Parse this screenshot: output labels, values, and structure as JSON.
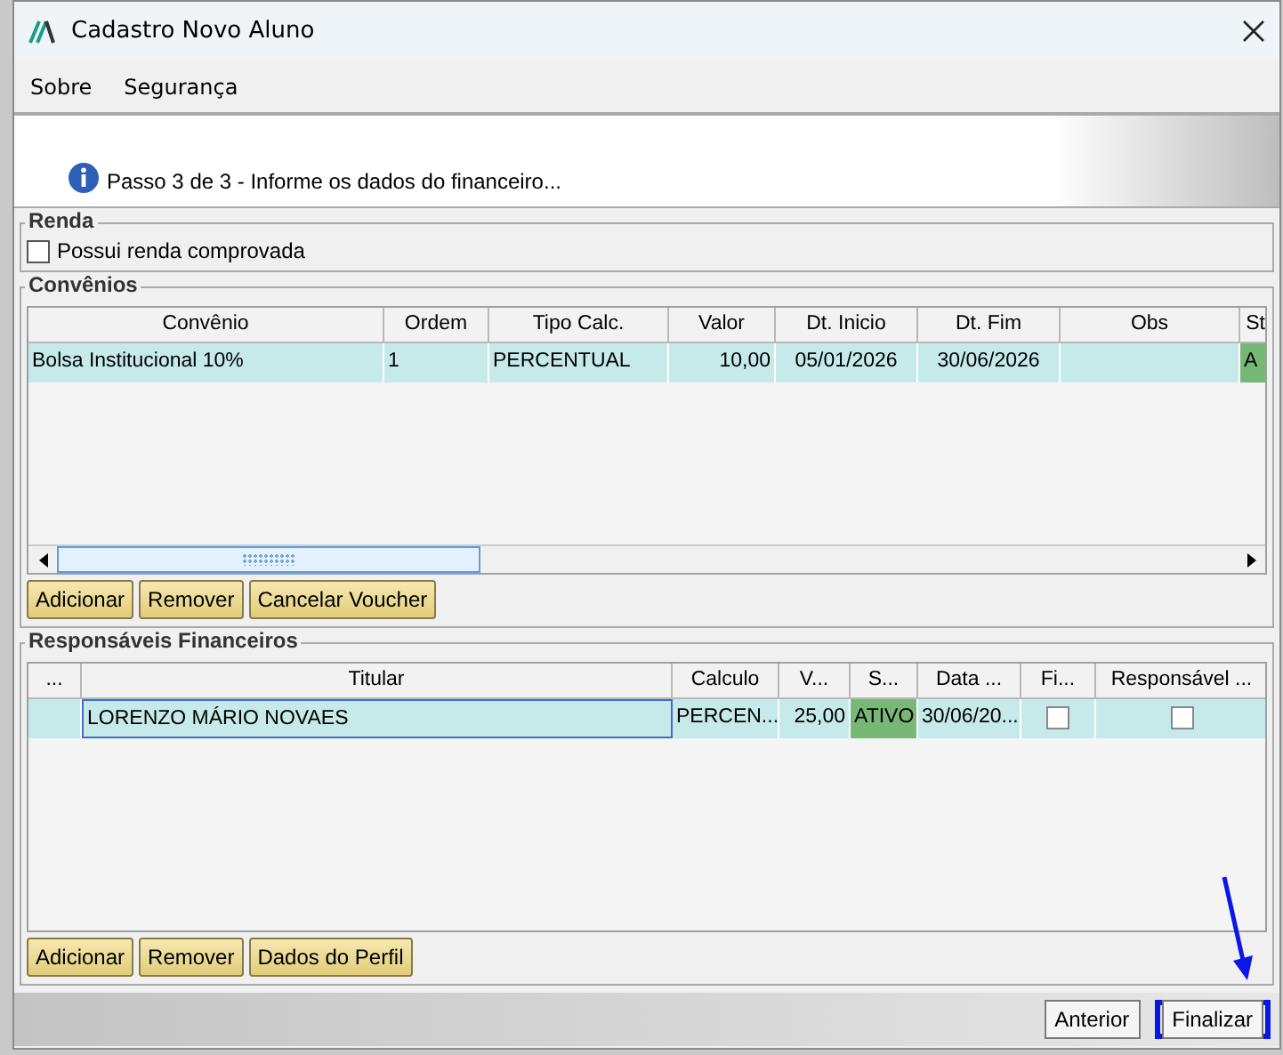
{
  "window": {
    "title": "Cadastro Novo Aluno"
  },
  "menu": [
    "Sobre",
    "Segurança"
  ],
  "banner": {
    "text": "Passo 3 de 3 - Informe os dados do financeiro..."
  },
  "renda": {
    "title": "Renda",
    "checkbox": {
      "label": "Possui renda comprovada",
      "checked": false
    }
  },
  "convenios": {
    "title": "Convênios",
    "columns": [
      "Convênio",
      "Ordem",
      "Tipo Calc.",
      "Valor",
      "Dt. Inicio",
      "Dt. Fim",
      "Obs",
      "St"
    ],
    "rows": [
      {
        "selected": true,
        "cells": [
          {
            "kind": "text",
            "text": "Bolsa Institucional 10%"
          },
          {
            "kind": "text",
            "text": "1"
          },
          {
            "kind": "text",
            "text": "PERCENTUAL"
          },
          {
            "kind": "number",
            "text": "10,00"
          },
          {
            "kind": "date",
            "text": "05/01/2026"
          },
          {
            "kind": "date",
            "text": "30/06/2026"
          },
          {
            "kind": "empty"
          },
          {
            "kind": "status",
            "text": "A"
          }
        ]
      }
    ],
    "buttons": [
      "Adicionar",
      "Remover",
      "Cancelar Voucher"
    ]
  },
  "responsaveis": {
    "title": "Responsáveis Financeiros",
    "columns": [
      "...",
      "Titular",
      "Calculo",
      "V...",
      "S...",
      "Data ...",
      "Fi...",
      "Responsável ..."
    ],
    "rows": [
      {
        "selected": true,
        "cells": [
          {
            "kind": "empty"
          },
          {
            "kind": "text",
            "text": "LORENZO MÁRIO NOVAES",
            "focused": true
          },
          {
            "kind": "text",
            "text": "PERCEN..."
          },
          {
            "kind": "number",
            "text": "25,00"
          },
          {
            "kind": "status",
            "text": "ATIVO"
          },
          {
            "kind": "text",
            "text": "30/06/20..."
          },
          {
            "kind": "checkbox",
            "checked": false
          },
          {
            "kind": "checkbox",
            "checked": false
          }
        ]
      }
    ],
    "buttons": [
      "Adicionar",
      "Remover",
      "Dados do Perfil"
    ]
  },
  "footer": {
    "buttons": [
      {
        "label": "Anterior",
        "highlighted": false
      },
      {
        "label": "Finalizar",
        "highlighted": true
      }
    ]
  }
}
